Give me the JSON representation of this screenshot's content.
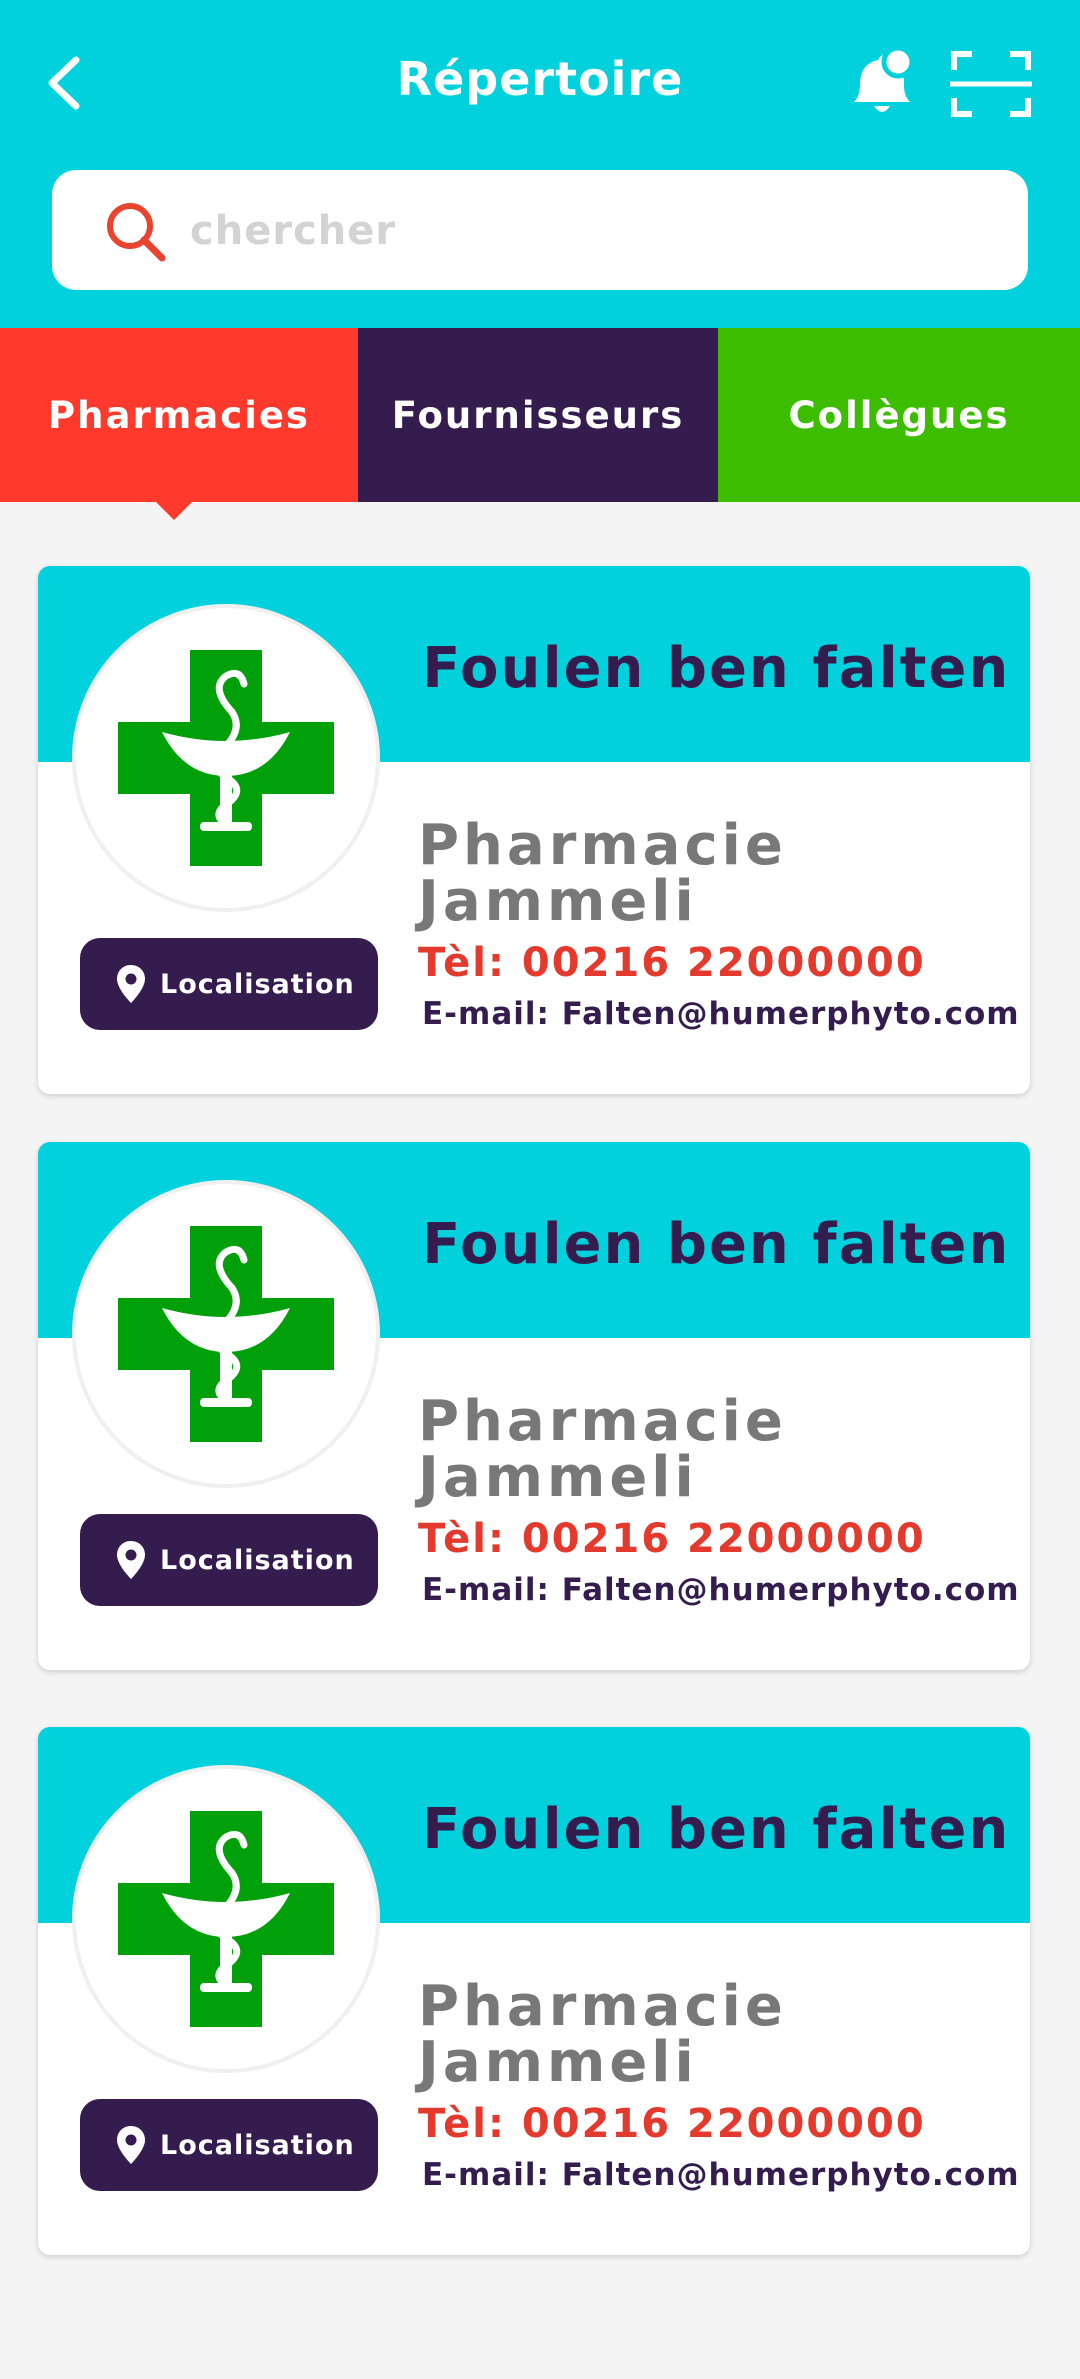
{
  "header": {
    "title": "Répertoire",
    "back_icon": "chevron-left-icon",
    "notification_icon": "bell-icon",
    "scan_icon": "scan-icon",
    "background_color": "#00d1dc"
  },
  "search": {
    "placeholder": "chercher",
    "value": "",
    "icon": "search-icon",
    "icon_color": "#e8442f"
  },
  "tabs": [
    {
      "label": "Pharmacies",
      "color": "#ff3a2c",
      "active": true
    },
    {
      "label": "Fournisseurs",
      "color": "#341c4e",
      "active": false
    },
    {
      "label": "Collègues",
      "color": "#3dbd00",
      "active": false
    }
  ],
  "cards": [
    {
      "name": "Foulen ben falten",
      "pharmacy": "Pharmacie Jammeli",
      "phone": "Tèl: 00216 22000000",
      "email": "E-mail: Falten@humerphyto.com",
      "location_label": "Localisation",
      "logo_icon": "pharmacy-cross-icon"
    },
    {
      "name": "Foulen ben falten",
      "pharmacy": "Pharmacie Jammeli",
      "phone": "Tèl: 00216 22000000",
      "email": "E-mail: Falten@humerphyto.com",
      "location_label": "Localisation",
      "logo_icon": "pharmacy-cross-icon"
    },
    {
      "name": "Foulen ben falten",
      "pharmacy": "Pharmacie Jammeli",
      "phone": "Tèl: 00216 22000000",
      "email": "E-mail: Falten@humerphyto.com",
      "location_label": "Localisation",
      "logo_icon": "pharmacy-cross-icon"
    }
  ],
  "colors": {
    "cyan": "#00d1dc",
    "purple": "#341c4e",
    "red": "#e4392d",
    "green": "#00a00a",
    "gray_text": "#787878"
  }
}
